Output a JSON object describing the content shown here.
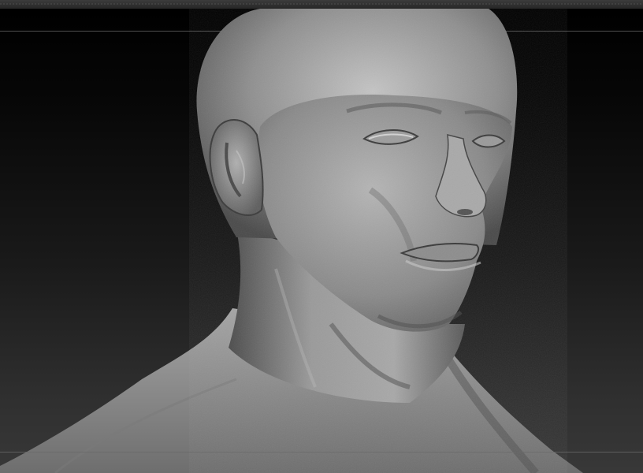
{
  "app": {
    "name": "",
    "viewport": {
      "background_colors": [
        "#000000",
        "#383838"
      ],
      "model_color": "#8f8f8f",
      "highlight_color": "#d0d0d0",
      "shadow_color": "#2a2a2a"
    },
    "icons": [
      "ear",
      "eye",
      "nose",
      "mouth"
    ]
  }
}
